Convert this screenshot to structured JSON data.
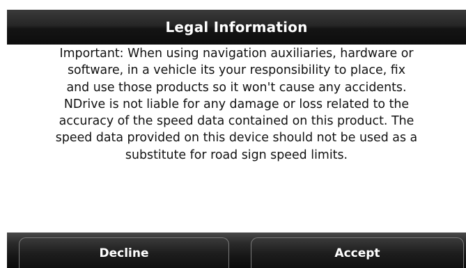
{
  "dialog": {
    "title": "Legal Information",
    "body_lines": [
      "Important: When using navigation auxiliaries, hardware or",
      "software, in a vehicle its your responsibility to place, fix",
      "and use those products so it won't cause any accidents.",
      "NDrive is not liable for any damage or loss related to the",
      "accuracy of the speed data contained on this product. The",
      "speed data provided on this device should not be used as a",
      "substitute for road sign speed limits."
    ],
    "decline_label": "Decline",
    "accept_label": "Accept"
  }
}
